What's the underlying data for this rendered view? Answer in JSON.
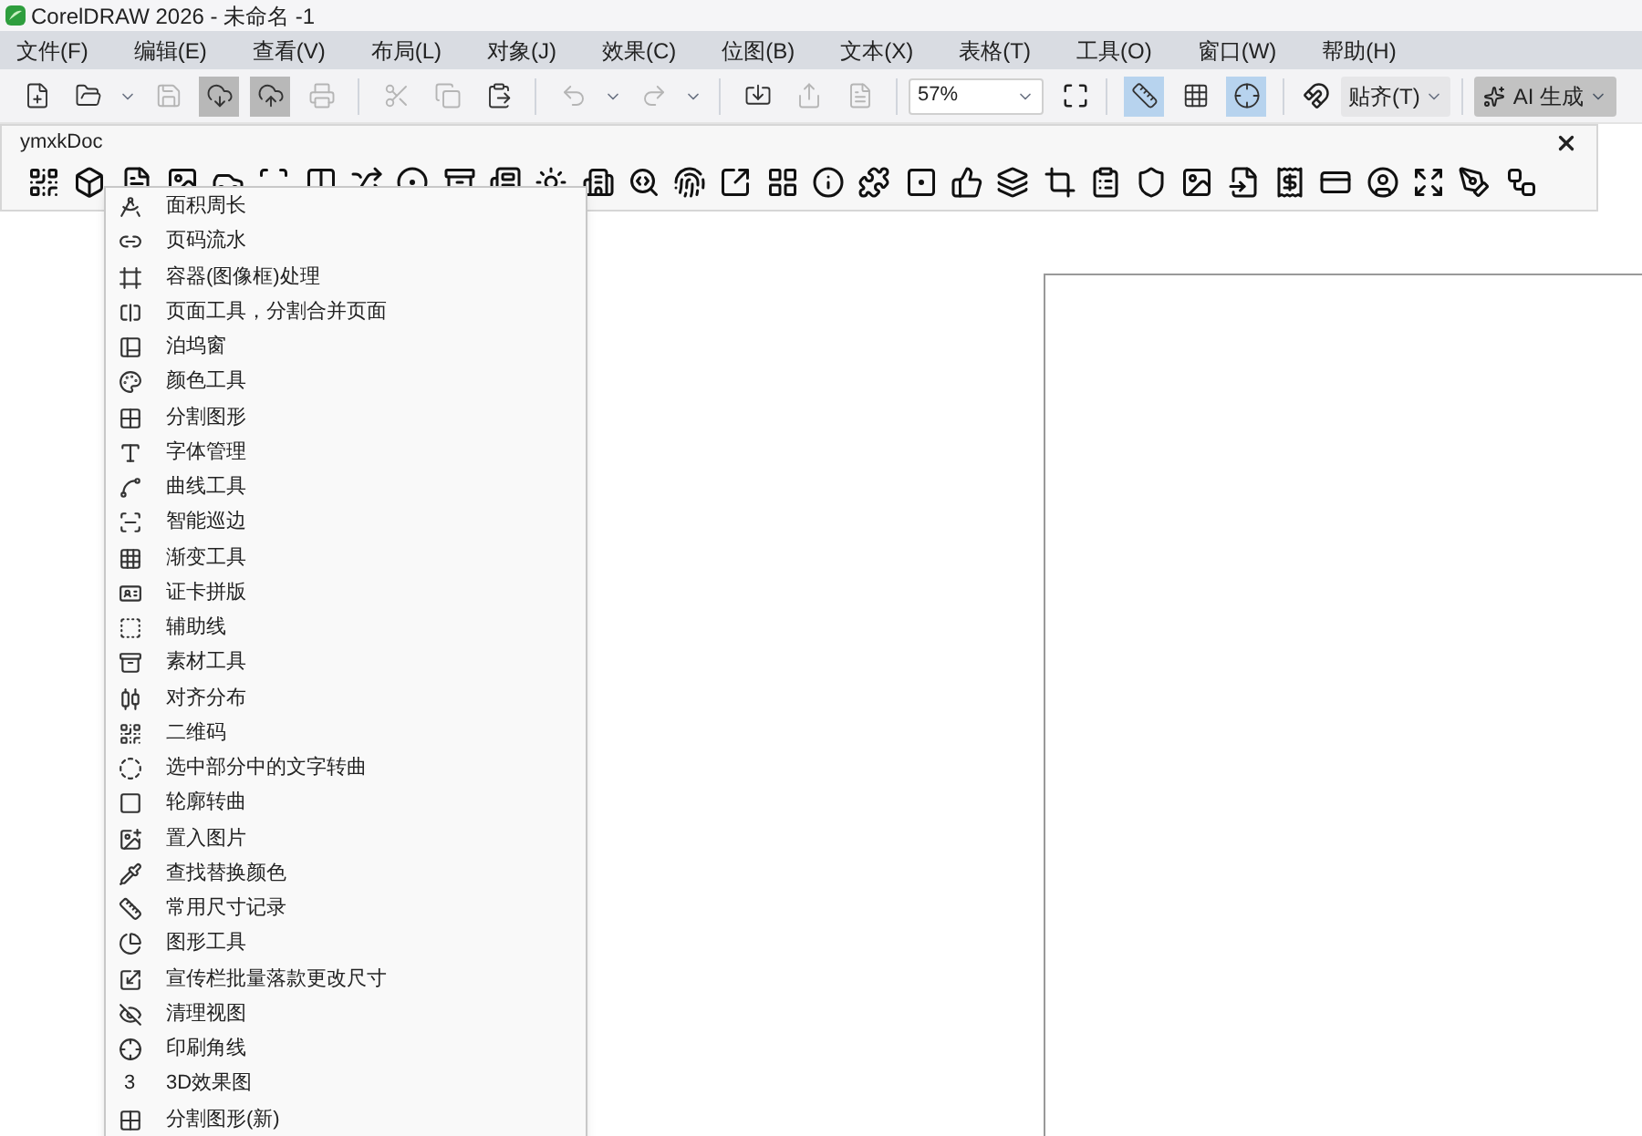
{
  "window": {
    "title": "CorelDRAW 2026 - 未命名 -1"
  },
  "menu_bar": [
    "文件(F)",
    "编辑(E)",
    "查看(V)",
    "布局(L)",
    "对象(J)",
    "效果(C)",
    "位图(B)",
    "文本(X)",
    "表格(T)",
    "工具(O)",
    "窗口(W)",
    "帮助(H)"
  ],
  "toolbar": {
    "buttons": [
      {
        "selected": false,
        "disabled": false
      },
      {
        "selected": false,
        "disabled": false
      },
      {
        "selected": false,
        "disabled": true
      },
      {
        "selected": true,
        "disabled": false
      },
      {
        "selected": true,
        "disabled": false
      },
      {
        "selected": false,
        "disabled": true
      },
      {
        "selected": false,
        "disabled": true
      },
      {
        "selected": false,
        "disabled": true
      },
      {
        "selected": false,
        "disabled": false
      },
      {
        "selected": false,
        "disabled": true
      },
      {
        "selected": false,
        "disabled": true
      },
      {
        "selected": false,
        "disabled": false
      },
      {
        "selected": false,
        "disabled": true
      },
      {
        "selected": false,
        "disabled": true
      }
    ],
    "zoom": "57%",
    "view_toggles": [
      {
        "selected": true
      },
      {
        "selected": false
      },
      {
        "selected": true
      }
    ],
    "snap": "贴齐(T)",
    "ai": "AI 生成"
  },
  "docker": {
    "title": "ymxkDoc"
  },
  "dropdown": {
    "items": [
      {
        "label": "面积周长"
      },
      {
        "label": "页码流水"
      },
      {
        "label": "容器(图像框)处理"
      },
      {
        "label": "页面工具，分割合并页面"
      },
      {
        "label": "泊坞窗"
      },
      {
        "label": "颜色工具"
      },
      {
        "label": "分割图形"
      },
      {
        "label": "字体管理"
      },
      {
        "label": "曲线工具"
      },
      {
        "label": "智能巡边"
      },
      {
        "label": "渐变工具"
      },
      {
        "label": "证卡拼版"
      },
      {
        "label": "辅助线"
      },
      {
        "label": "素材工具"
      },
      {
        "label": "对齐分布"
      },
      {
        "label": "二维码"
      },
      {
        "label": "选中部分中的文字转曲"
      },
      {
        "label": "轮廓转曲"
      },
      {
        "label": "置入图片"
      },
      {
        "label": "查找替换颜色"
      },
      {
        "label": "常用尺寸记录"
      },
      {
        "label": "图形工具"
      },
      {
        "label": "宣传栏批量落款更改尺寸"
      },
      {
        "label": "清理视图"
      },
      {
        "label": "印刷角线"
      },
      {
        "label": "3D效果图",
        "glyph": "3"
      },
      {
        "label": "分割图形(新)"
      }
    ]
  }
}
